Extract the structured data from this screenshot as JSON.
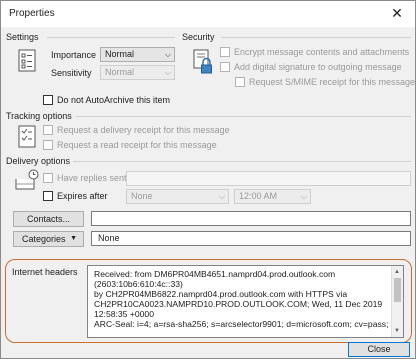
{
  "window": {
    "title": "Properties",
    "close_glyph": "✕"
  },
  "settings": {
    "header": "Settings",
    "importance_label": "Importance",
    "importance_value": "Normal",
    "sensitivity_label": "Sensitivity",
    "sensitivity_value": "Normal",
    "autoarchive_label": "Do not AutoArchive this item"
  },
  "security": {
    "header": "Security",
    "encrypt_label": "Encrypt message contents and attachments",
    "signature_label": "Add digital signature to outgoing message",
    "smime_label": "Request S/MIME receipt for this message"
  },
  "tracking": {
    "header": "Tracking options",
    "delivery_receipt_label": "Request a delivery receipt for this message",
    "read_receipt_label": "Request a read receipt for this message"
  },
  "delivery": {
    "header": "Delivery options",
    "replies_label": "Have replies sent to",
    "replies_value": "",
    "expires_label": "Expires after",
    "expires_date": "None",
    "expires_time": "12:00 AM"
  },
  "contacts_button": "Contacts...",
  "contacts_value": "",
  "categories_button": "Categories",
  "categories_value": "None",
  "internet_headers": {
    "label": "Internet headers",
    "lines": [
      "Received: from DM6PR04MB4651.namprd04.prod.outlook.com",
      "(2603:10b6:610:4c::33)",
      " by CH2PR04MB6822.namprd04.prod.outlook.com with HTTPS via",
      " CH2PR10CA0023.NAMPRD10.PROD.OUTLOOK.COM; Wed, 11 Dec 2019",
      "12:58:35 +0000",
      "ARC-Seal: i=4; a=rsa-sha256; s=arcselector9901; d=microsoft.com; cv=pass;"
    ]
  },
  "close_button": "Close",
  "colors": {
    "highlight": "#c86f30",
    "accent": "#0078d7"
  },
  "icons": [
    "settings-icon",
    "lock-icon",
    "tracking-icon",
    "delivery-icon",
    "close-icon",
    "dropdown-arrow-icon"
  ]
}
